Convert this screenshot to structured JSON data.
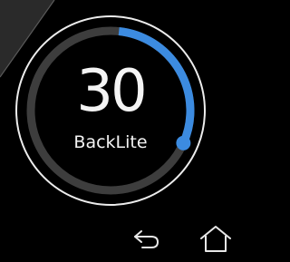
{
  "backlight": {
    "value": "30",
    "label": "BackLite",
    "level_percent": 30
  },
  "nav": {
    "back_icon": "back-arrow-icon",
    "home_icon": "home-icon"
  },
  "colors": {
    "background": "#000000",
    "accent": "#3c8be0",
    "track": "#3d3d3d",
    "ring": "#ececec",
    "text": "#f4f4f4"
  }
}
